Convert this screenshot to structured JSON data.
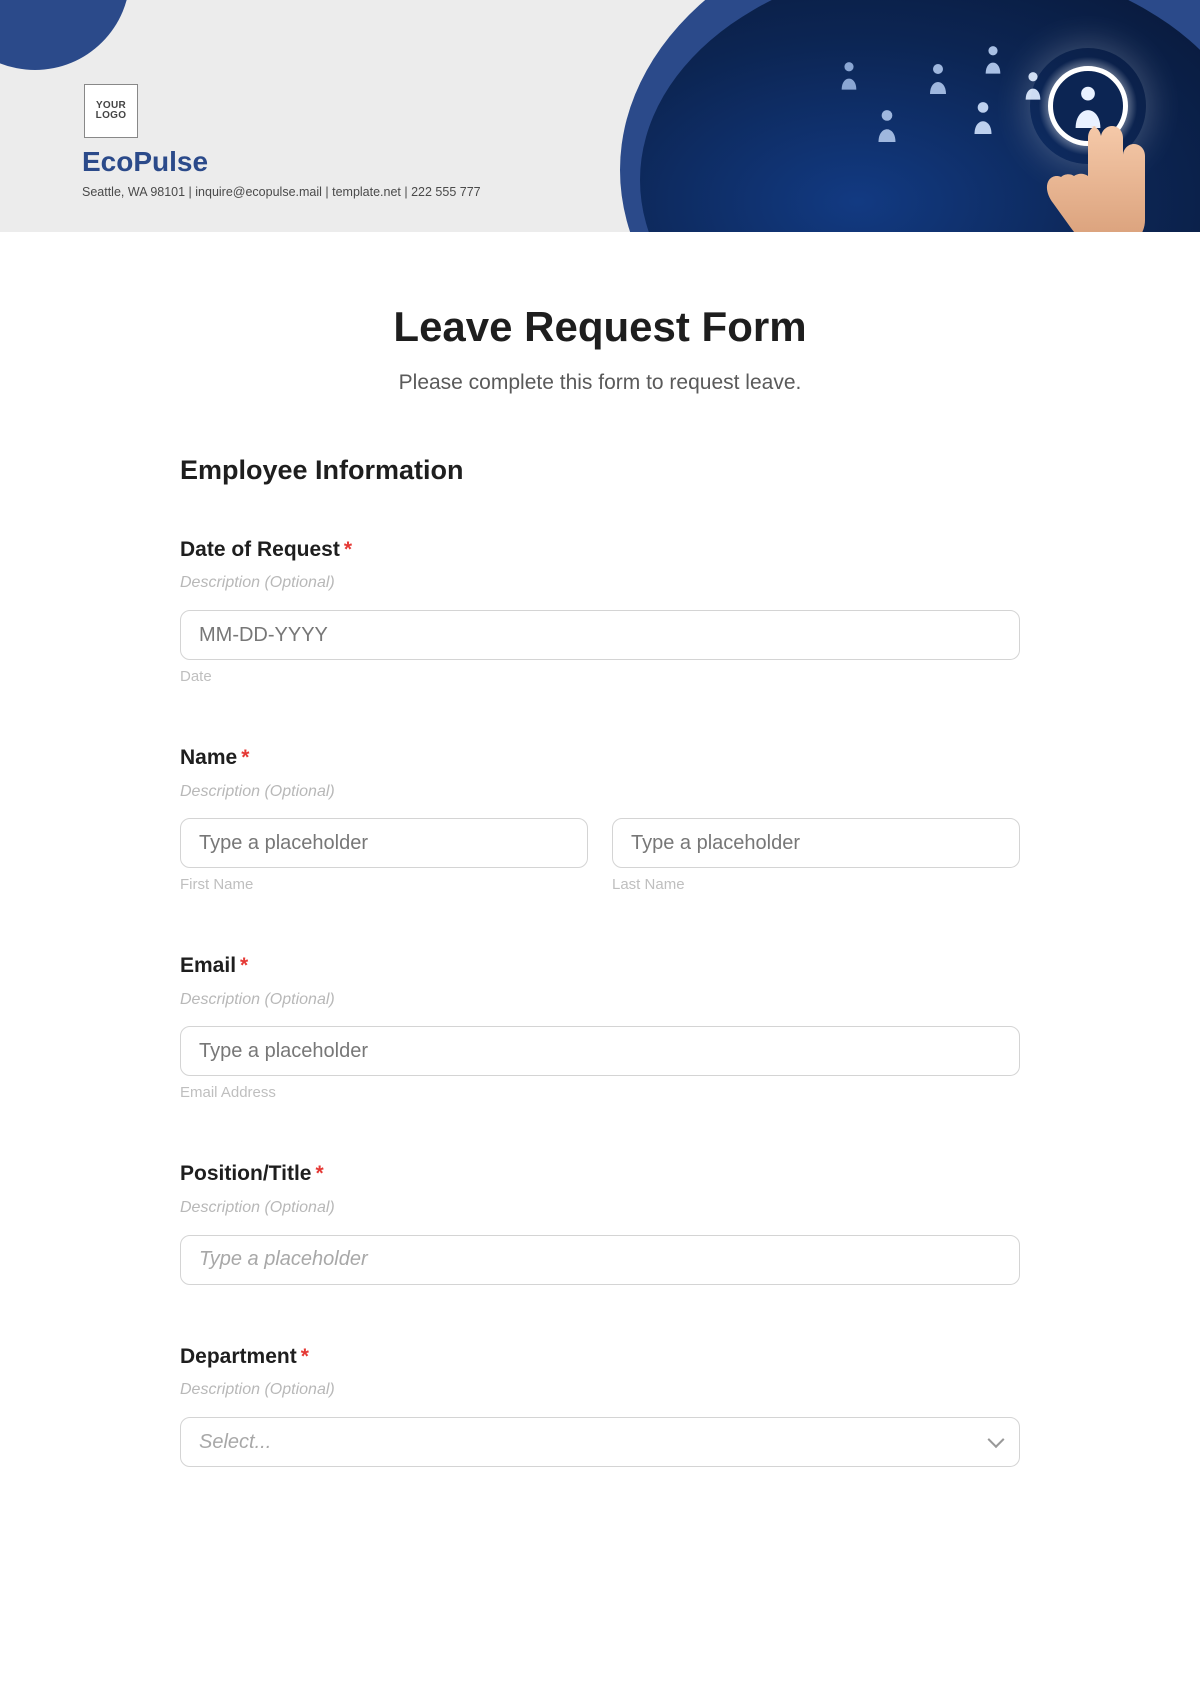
{
  "header": {
    "logo_text": "YOUR\nLOGO",
    "brand": "EcoPulse",
    "contact": "Seattle, WA 98101 | inquire@ecopulse.mail | template.net | 222 555 777"
  },
  "form": {
    "title": "Leave Request Form",
    "subtitle": "Please complete this form to request leave.",
    "section1_title": "Employee Information",
    "desc_placeholder_text": "Description (Optional)",
    "fields": {
      "date_of_request": {
        "label": "Date of Request",
        "placeholder": "MM-DD-YYYY",
        "sublabel": "Date"
      },
      "name": {
        "label": "Name",
        "first_placeholder": "Type a placeholder",
        "last_placeholder": "Type a placeholder",
        "first_sub": "First Name",
        "last_sub": "Last Name"
      },
      "email": {
        "label": "Email",
        "placeholder": "Type a placeholder",
        "sublabel": "Email Address"
      },
      "position": {
        "label": "Position/Title",
        "placeholder": "Type a placeholder"
      },
      "department": {
        "label": "Department",
        "placeholder": "Select..."
      }
    },
    "required_marker": "*"
  }
}
